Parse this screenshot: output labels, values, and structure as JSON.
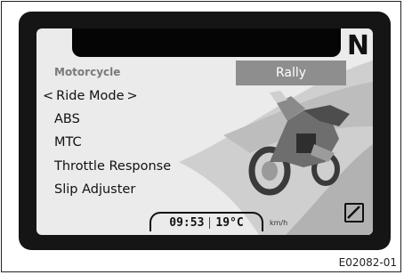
{
  "dashboard": {
    "gear": "N",
    "section_label": "Motorcycle",
    "riding_mode_value": "Rally",
    "menu": {
      "items": [
        {
          "label": "Ride Mode",
          "chevron_left": "<",
          "chevron_right": ">"
        },
        {
          "label": "ABS"
        },
        {
          "label": "MTC"
        },
        {
          "label": "Throttle Response"
        },
        {
          "label": "Slip Adjuster"
        }
      ]
    },
    "status": {
      "time": "09:53",
      "temperature": "19°C",
      "speed_unit": "km/h"
    },
    "icons": {
      "bottom_right": "zero-icon"
    }
  },
  "figure_code": "E02082-01",
  "colors": {
    "bezel": "#151515",
    "screen": "#ebebeb",
    "highlight_box": "#8e8e8e"
  }
}
